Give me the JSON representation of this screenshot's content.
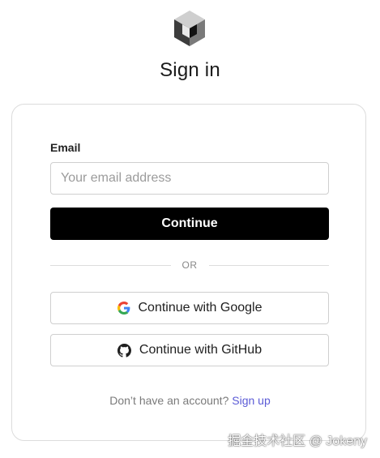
{
  "brand": {
    "logo_icon": "cube-icon"
  },
  "page": {
    "title": "Sign in"
  },
  "form": {
    "email_label": "Email",
    "email_placeholder": "Your email address",
    "email_value": "",
    "continue_label": "Continue",
    "divider_text": "OR"
  },
  "oauth": {
    "google": {
      "label": "Continue with Google",
      "icon": "google-icon"
    },
    "github": {
      "label": "Continue with GitHub",
      "icon": "github-icon"
    }
  },
  "footer": {
    "prompt": "Don’t have an account?",
    "signup_label": "Sign up"
  },
  "watermark": {
    "text": "掘金技术社区 @ Jokeny"
  },
  "colors": {
    "primary_button": "#000000",
    "link": "#5b5bd6",
    "border": "#cfcfcf"
  }
}
